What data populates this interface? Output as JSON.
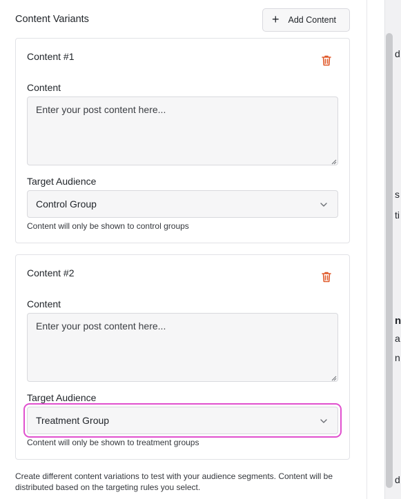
{
  "header": {
    "title": "Content Variants",
    "add_button_label": "Add Content",
    "add_icon": "plus-icon"
  },
  "cards": [
    {
      "title": "Content #1",
      "content_label": "Content",
      "content_placeholder": "Enter your post content here...",
      "audience_label": "Target Audience",
      "audience_value": "Control Group",
      "hint": "Content will only be shown to control groups"
    },
    {
      "title": "Content #2",
      "content_label": "Content",
      "content_placeholder": "Enter your post content here...",
      "audience_label": "Target Audience",
      "audience_value": "Treatment Group",
      "hint": "Content will only be shown to treatment groups"
    }
  ],
  "footer": {
    "text": "Create different content variations to test with your audience segments. Content will be distributed based on the targeting rules you select."
  },
  "right_edge_fragments": [
    "d",
    "s",
    "ti",
    "nc",
    "a",
    "n",
    "d"
  ],
  "colors": {
    "trash": "#e05a2b",
    "focus_ring": "#e04fce",
    "field_bg": "#f6f6f7",
    "border": "#e1e2e6"
  }
}
